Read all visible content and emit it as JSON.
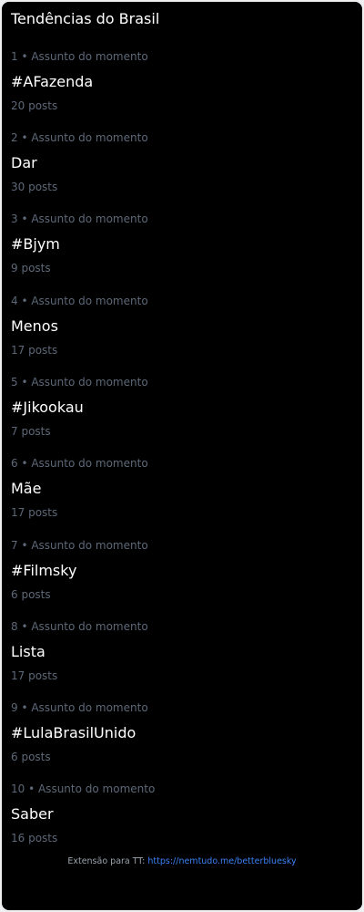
{
  "panel": {
    "title": "Tendências do Brasil"
  },
  "trends": [
    {
      "rank": "1 • Assunto do momento",
      "name": "#AFazenda",
      "posts": "20 posts"
    },
    {
      "rank": "2 • Assunto do momento",
      "name": "Dar",
      "posts": "30 posts"
    },
    {
      "rank": "3 • Assunto do momento",
      "name": "#Bjym",
      "posts": "9 posts"
    },
    {
      "rank": "4 • Assunto do momento",
      "name": "Menos",
      "posts": "17 posts"
    },
    {
      "rank": "5 • Assunto do momento",
      "name": "#Jikookau",
      "posts": "7 posts"
    },
    {
      "rank": "6 • Assunto do momento",
      "name": "Mãe",
      "posts": "17 posts"
    },
    {
      "rank": "7 • Assunto do momento",
      "name": "#Filmsky",
      "posts": "6 posts"
    },
    {
      "rank": "8 • Assunto do momento",
      "name": "Lista",
      "posts": "17 posts"
    },
    {
      "rank": "9 • Assunto do momento",
      "name": "#LulaBrasilUnido",
      "posts": "6 posts"
    },
    {
      "rank": "10 • Assunto do momento",
      "name": "Saber",
      "posts": "16 posts"
    }
  ],
  "footer": {
    "label": "Extensão para TT: ",
    "link_text": "https://nemtudo.me/betterbluesky"
  },
  "colors": {
    "background": "#000000",
    "primary_text": "#ffffff",
    "secondary_text": "#5d6878",
    "link": "#3b82f6"
  }
}
